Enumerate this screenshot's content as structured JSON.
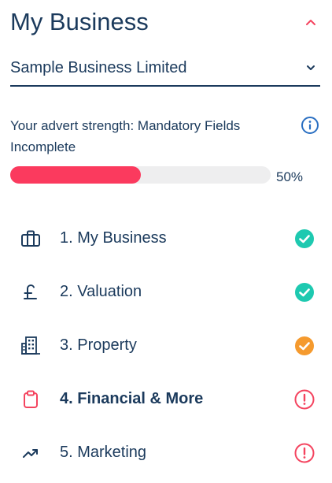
{
  "header": {
    "title": "My Business"
  },
  "business_select": {
    "value": "Sample Business Limited"
  },
  "advert_strength": {
    "text": "Your advert strength: Mandatory Fields Incomplete",
    "progress_percent": 50,
    "progress_label": "50%"
  },
  "steps": [
    {
      "label": "1. My Business",
      "icon": "briefcase-icon",
      "status": "complete"
    },
    {
      "label": "2. Valuation",
      "icon": "pound-icon",
      "status": "complete"
    },
    {
      "label": "3. Property",
      "icon": "building-icon",
      "status": "partial"
    },
    {
      "label": "4. Financial & More",
      "icon": "clipboard-icon",
      "status": "incomplete",
      "active": true
    },
    {
      "label": "5. Marketing",
      "icon": "trending-up-icon",
      "status": "incomplete"
    }
  ],
  "colors": {
    "text": "#1b3a5c",
    "accent": "#fb3a5e",
    "complete": "#1ec9b0",
    "partial": "#f59a2e",
    "incomplete": "#f4445f",
    "info": "#2a6fc2"
  }
}
